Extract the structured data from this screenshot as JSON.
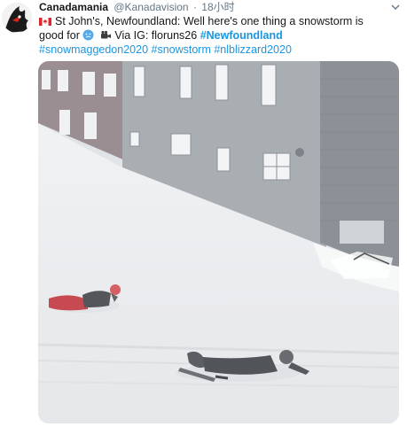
{
  "tweet": {
    "author_name": "Canadamania",
    "author_handle": "@Kanadavision",
    "separator": "·",
    "time": "18小时",
    "text_line1": "St John's, Newfoundland: Well here's one thing a snowstorm is",
    "text_good_for": "good for",
    "text_via": "Via IG: floruns26",
    "hashtag_newfoundland": "#Newfoundland",
    "hashtags_line3": "#snowmaggedon2020 #snowstorm #nlblizzard2020"
  },
  "icons": {
    "flag": "canada-flag-icon",
    "snow_emoji": "snow-face-emoji-icon",
    "camera": "movie-camera-icon",
    "caret": "chevron-down-icon"
  },
  "colors": {
    "link": "#1b95e0",
    "text": "#14171a",
    "muted": "#657786"
  }
}
